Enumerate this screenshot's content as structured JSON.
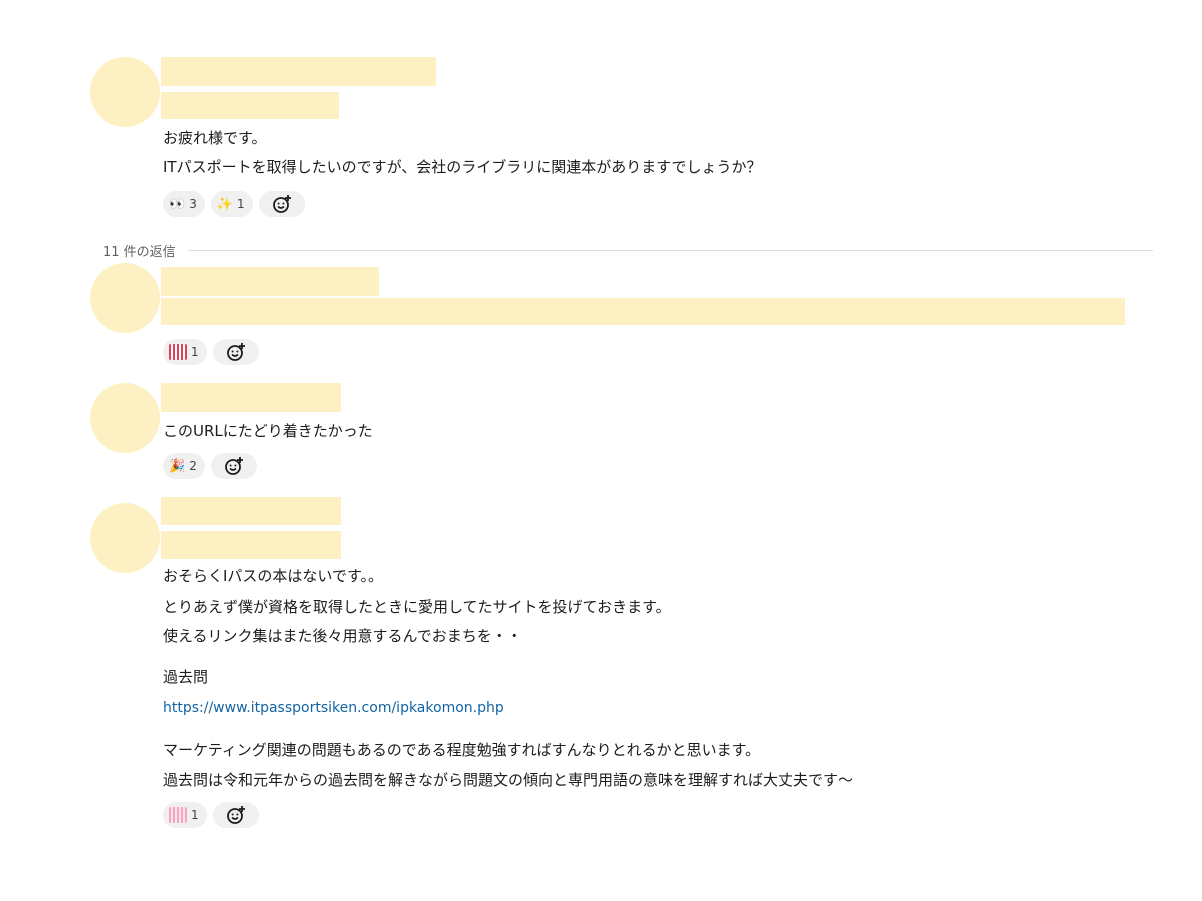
{
  "messages": [
    {
      "text_lines": [
        "お疲れ様です。",
        "ITパスポートを取得したいのですが、会社のライブラリに関連本がありますでしょうか？"
      ],
      "reactions": [
        {
          "emoji": "👀",
          "count": "3"
        },
        {
          "emoji": "✨",
          "count": "1"
        }
      ]
    }
  ],
  "thread": {
    "replies_label": "11 件の返信",
    "replies": [
      {
        "reactions": [
          {
            "emoji": "gambare",
            "count": "1"
          }
        ]
      },
      {
        "text": "このURLにたどり着きたかった",
        "reactions": [
          {
            "emoji": "🎉",
            "count": "2"
          }
        ]
      },
      {
        "text_lines": [
          "おそらくIパスの本はないです。。",
          "とりあえず僕が資格を取得したときに愛用してたサイトを投げておきます。",
          "使えるリンク集はまた後々用意するんでおまちを・・"
        ],
        "section_title": "過去問",
        "link": "https://www.itpassportsiken.com/ipkakomon.php",
        "closing_lines": [
          "マーケティング関連の問題もあるのである程度勉強すればすんなりとれるかと思います。",
          "過去問は令和元年からの過去問を解きながら問題文の傾向と専門用語の意味を理解すれば大丈夫です～"
        ],
        "reactions": [
          {
            "emoji": "pink-sticker",
            "count": "1"
          }
        ]
      }
    ]
  },
  "icons": {
    "add_reaction": "add-reaction-icon"
  }
}
